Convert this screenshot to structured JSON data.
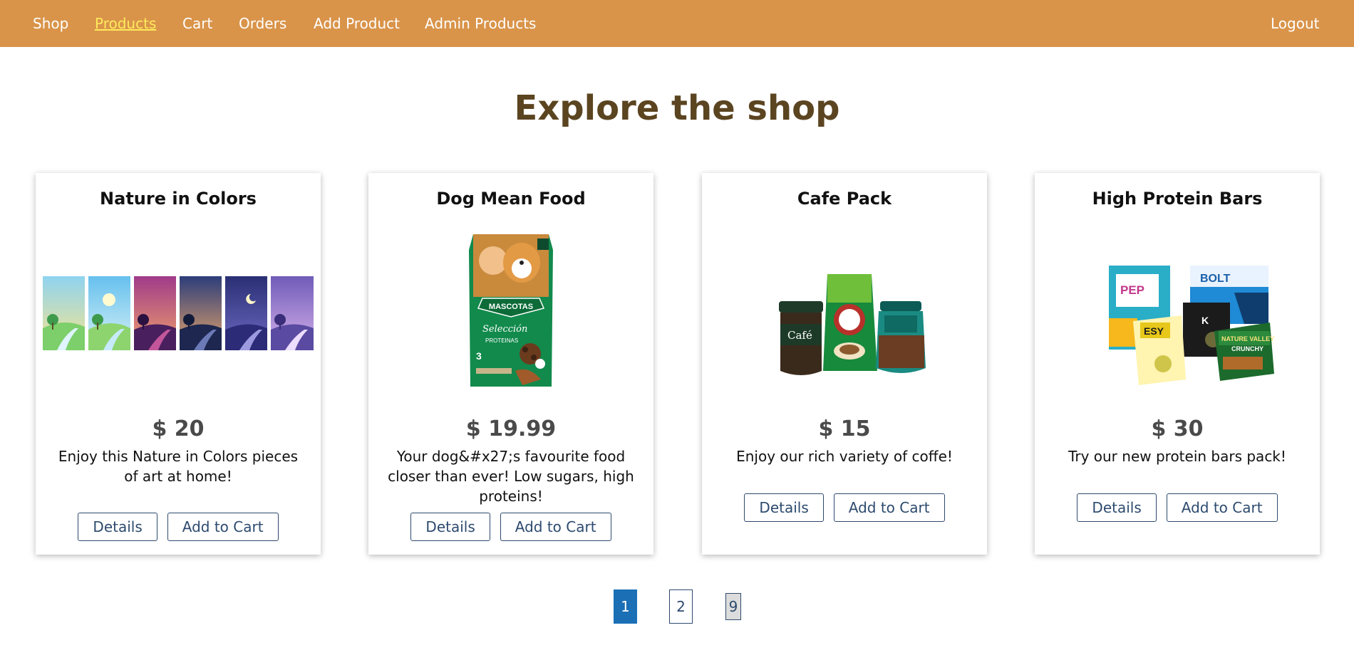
{
  "nav": {
    "shop": "Shop",
    "products": "Products",
    "cart": "Cart",
    "orders": "Orders",
    "add_product": "Add Product",
    "admin_products": "Admin Products",
    "logout": "Logout"
  },
  "page": {
    "title": "Explore the shop"
  },
  "products": [
    {
      "title": "Nature in Colors",
      "price": "$ 20",
      "description": "Enjoy this Nature in Colors pieces of art at home!",
      "details_label": "Details",
      "add_label": "Add to Cart",
      "image": "nature-art-panels"
    },
    {
      "title": "Dog Mean Food",
      "price": "$ 19.99",
      "description": "Your dog&#x27;s favourite food closer than ever! Low sugars, high proteins!",
      "details_label": "Details",
      "add_label": "Add to Cart",
      "image": "dog-food-bag",
      "image_text": {
        "brand": "MASCOTAS",
        "line": "Selección",
        "line2": "PROTEINAS"
      }
    },
    {
      "title": "Cafe Pack",
      "price": "$ 15",
      "description": "Enjoy our rich variety of coffe!",
      "details_label": "Details",
      "add_label": "Add to Cart",
      "image": "coffee-products",
      "image_text": {
        "jar": "Café"
      }
    },
    {
      "title": "High Protein Bars",
      "price": "$ 30",
      "description": "Try our new protein bars pack!",
      "details_label": "Details",
      "add_label": "Add to Cart",
      "image": "protein-bar-boxes",
      "image_text": {
        "box1": "PEP",
        "box2": "BOLT",
        "box3": "ESY",
        "box4": "NATURE VALLEY",
        "box4b": "CRUNCHY"
      }
    }
  ],
  "pagination": {
    "first": "1",
    "second": "2",
    "last": "9",
    "current": "1"
  },
  "colors": {
    "header": "#d9944a",
    "active_nav": "#ffea5a",
    "title": "#5b4420",
    "button_border": "#2d4a6e",
    "active_page": "#1a6fb5"
  }
}
